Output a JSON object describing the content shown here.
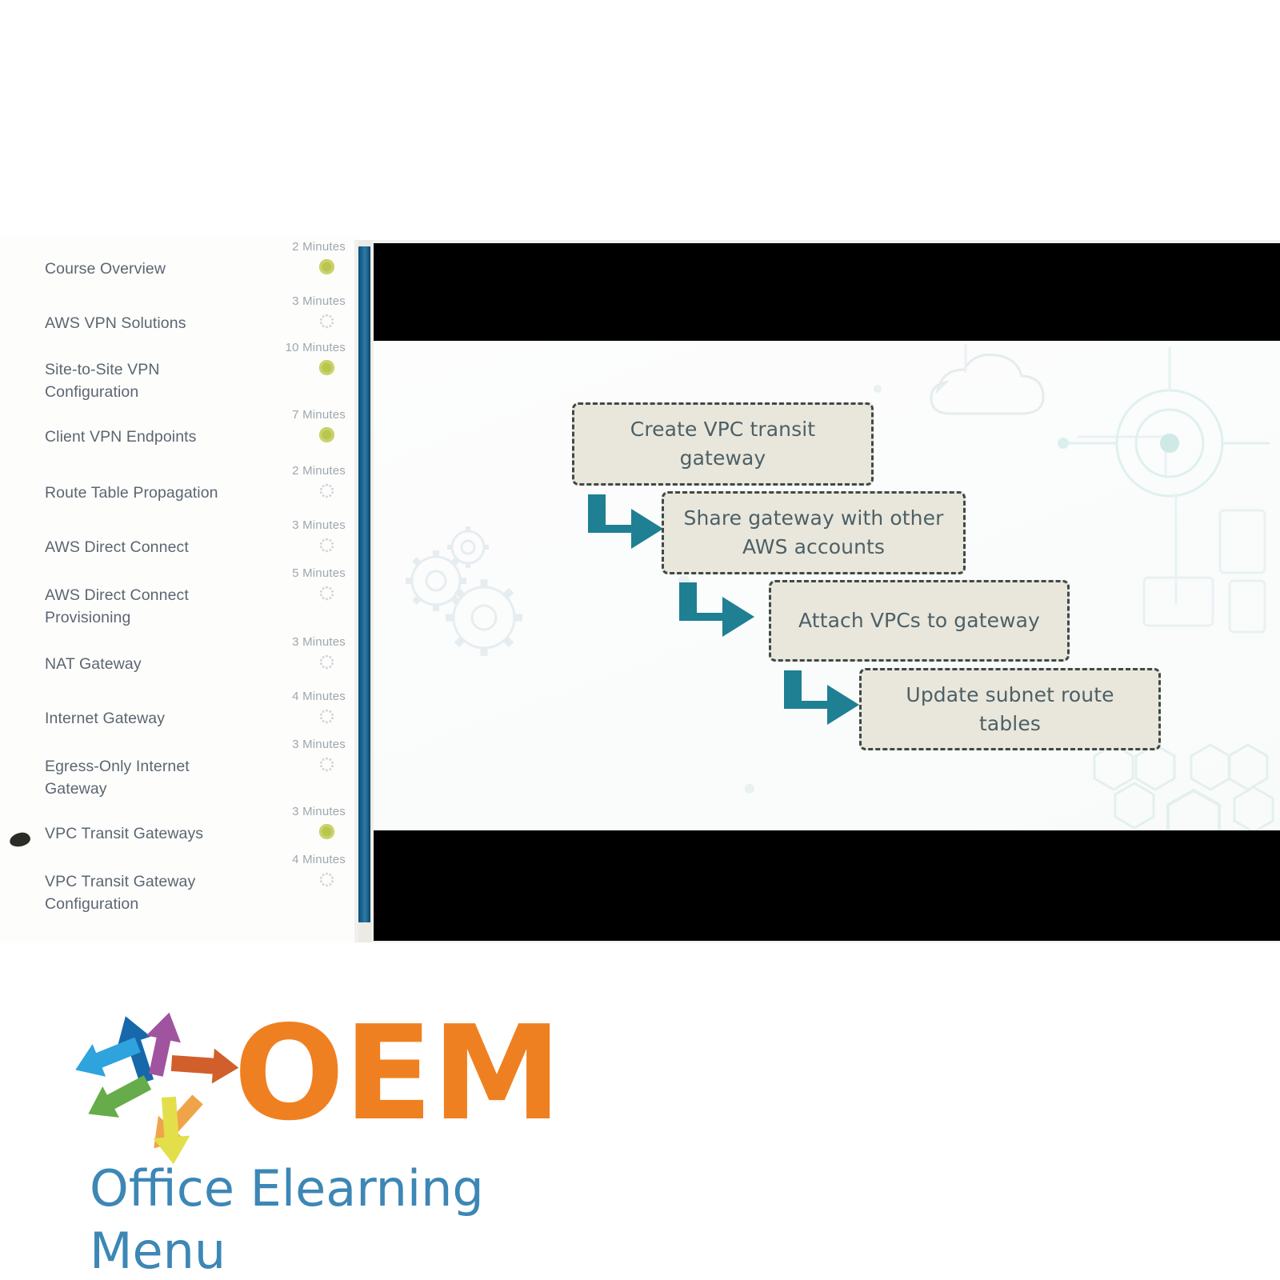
{
  "colors": {
    "sidebar_text": "#5c6670",
    "minutes_text": "#9ea7ad",
    "status_done": "#b4c141",
    "status_todo": "#d3d7da",
    "scrollbar_blue": "#1b6490",
    "letterbox": "#000000",
    "flow_box_fill": "#e9e7dc",
    "flow_box_border": "#3f4a46",
    "flow_text": "#4e6066",
    "flow_arrow": "#1f7f93",
    "logo_orange": "#ef8021",
    "logo_blue": "#3c87b5",
    "slide_bg": "#fbfcfc"
  },
  "outline": {
    "items": [
      {
        "label": "Course Overview",
        "minutes": "2 Minutes",
        "status": "done",
        "current": false
      },
      {
        "label": "AWS VPN Solutions",
        "minutes": "3 Minutes",
        "status": "todo",
        "current": false
      },
      {
        "label": "Site-to-Site VPN Configuration",
        "minutes": "10 Minutes",
        "status": "done",
        "current": false
      },
      {
        "label": "Client VPN Endpoints",
        "minutes": "7 Minutes",
        "status": "done",
        "current": false
      },
      {
        "label": "Route Table Propagation",
        "minutes": "2 Minutes",
        "status": "todo",
        "current": false
      },
      {
        "label": "AWS Direct Connect",
        "minutes": "3 Minutes",
        "status": "todo",
        "current": false
      },
      {
        "label": "AWS Direct Connect Provisioning",
        "minutes": "5 Minutes",
        "status": "todo",
        "current": false
      },
      {
        "label": "NAT Gateway",
        "minutes": "3 Minutes",
        "status": "todo",
        "current": false
      },
      {
        "label": "Internet Gateway",
        "minutes": "4 Minutes",
        "status": "todo",
        "current": false
      },
      {
        "label": "Egress-Only Internet Gateway",
        "minutes": "3 Minutes",
        "status": "todo",
        "current": false
      },
      {
        "label": "VPC Transit Gateways",
        "minutes": "3 Minutes",
        "status": "done",
        "current": true
      },
      {
        "label": "VPC Transit Gateway Configuration",
        "minutes": "4 Minutes",
        "status": "todo",
        "current": false
      }
    ]
  },
  "slide": {
    "steps": [
      {
        "text": "Create VPC transit gateway"
      },
      {
        "text": "Share gateway with other AWS accounts"
      },
      {
        "text": "Attach VPCs to gateway"
      },
      {
        "text": "Update subnet route tables"
      }
    ]
  },
  "logo": {
    "wordmark": "OEM",
    "tagline": "Office Elearning Menu",
    "arrows": [
      {
        "name": "arrow-up-blue",
        "color": "#1767ab"
      },
      {
        "name": "arrow-up-purple",
        "color": "#a0549f"
      },
      {
        "name": "arrow-right-rust",
        "color": "#d15f2c"
      },
      {
        "name": "arrow-down-right-orange",
        "color": "#f0a44a"
      },
      {
        "name": "arrow-down-yellow",
        "color": "#e3df4a"
      },
      {
        "name": "arrow-down-left-green",
        "color": "#66ac4a"
      },
      {
        "name": "arrow-left-lightblue",
        "color": "#2ea3dd"
      }
    ]
  }
}
